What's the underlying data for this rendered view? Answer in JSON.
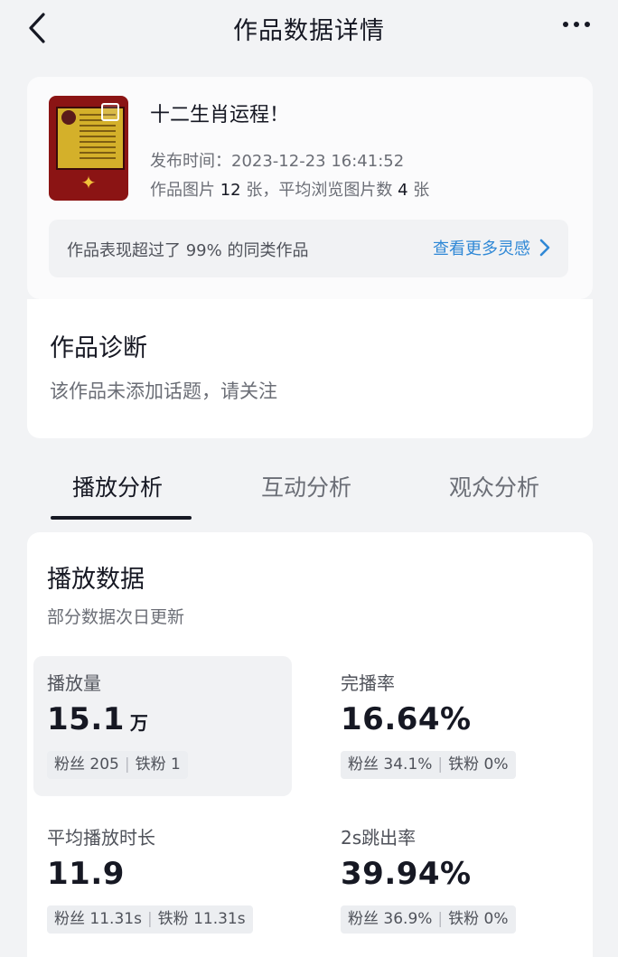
{
  "header": {
    "title": "作品数据详情"
  },
  "work": {
    "title": "十二生肖运程！",
    "publish_time": "发布时间：2023-12-23 16:41:52",
    "images_prefix": "作品图片 ",
    "images_count": "12",
    "images_mid": " 张，平均浏览图片数 ",
    "avg_view": "4",
    "images_suffix": " 张",
    "performance_text": "作品表现超过了 99% 的同类作品",
    "inspiration_link": "查看更多灵感"
  },
  "diagnosis": {
    "title": "作品诊断",
    "text": "该作品未添加话题，请关注"
  },
  "tabs": [
    {
      "label": "播放分析"
    },
    {
      "label": "互动分析"
    },
    {
      "label": "观众分析"
    }
  ],
  "play": {
    "title": "播放数据",
    "subtitle": "部分数据次日更新",
    "metrics": [
      {
        "label": "播放量",
        "value": "15.1",
        "unit": "万",
        "fans": "粉丝 205",
        "iron": "铁粉 1"
      },
      {
        "label": "完播率",
        "value": "16.64%",
        "unit": "",
        "fans": "粉丝 34.1%",
        "iron": "铁粉 0%"
      },
      {
        "label": "平均播放时长",
        "value": "11.9",
        "unit": "",
        "fans": "粉丝 11.31s",
        "iron": "铁粉 11.31s"
      },
      {
        "label": "2s跳出率",
        "value": "39.94%",
        "unit": "",
        "fans": "粉丝 36.9%",
        "iron": "铁粉 0%"
      }
    ]
  },
  "icons": {
    "back": "chevron-left-icon",
    "more": "more-dots-icon",
    "link": "chevron-right-icon"
  },
  "colors": {
    "accent_link": "#2f88d6",
    "text_primary": "#161823",
    "text_secondary": "#6b6e76"
  }
}
